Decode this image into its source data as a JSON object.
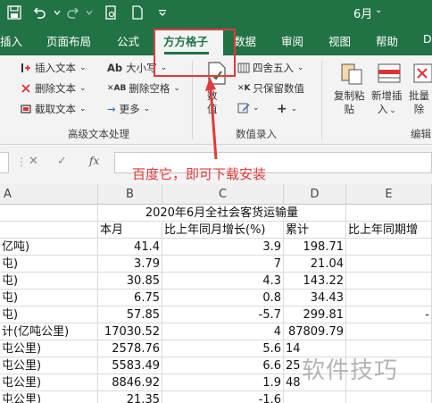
{
  "titlebar": {
    "doc_title": "6月",
    "title_dropdown": "⌄"
  },
  "tabs": [
    {
      "label": "插入",
      "active": false
    },
    {
      "label": "页面布局",
      "active": false
    },
    {
      "label": "公式",
      "active": false
    },
    {
      "label": "方方格子",
      "active": true
    },
    {
      "label": "数据",
      "active": false
    },
    {
      "label": "审阅",
      "active": false
    },
    {
      "label": "视图",
      "active": false
    },
    {
      "label": "帮助",
      "active": false
    },
    {
      "label": "D",
      "active": false
    }
  ],
  "ribbon": {
    "text_group": {
      "insert_text": "插入文本",
      "delete_text": "删除文本",
      "cut_text": "截取文本",
      "case": "大小写",
      "delete_space": "删除空格",
      "more": "更多",
      "label": "高级文本处理"
    },
    "number_group": {
      "round": "四舍五入",
      "keep_values": "只保留数值",
      "value_top": "数",
      "value_bottom": "值",
      "label": "数值录入"
    },
    "edit_group": {
      "copy_paste_top": "复制粘",
      "copy_paste_bottom": "贴",
      "new_insert_top": "新增插",
      "new_insert_bottom": "入",
      "batch_delete_top": "批量",
      "batch_delete_bottom": "除",
      "label": "编辑"
    }
  },
  "formula_bar": {
    "cancel": "✕",
    "confirm": "✓",
    "fx": "fx"
  },
  "annotation": {
    "callout": "百度它，即可下载安装",
    "watermark": "软件技巧"
  },
  "sheet": {
    "columns": [
      "A",
      "B",
      "C",
      "D",
      "E"
    ],
    "title_row": "2020年6月全社会客货运输量",
    "header_row": [
      "",
      "本月",
      "比上年同月增长(%)",
      "累计",
      "比上年同期增"
    ],
    "rows": [
      [
        "亿吨)",
        "41.4",
        "3.9",
        "198.71",
        ""
      ],
      [
        "屯)",
        "3.79",
        "7",
        "21.04",
        ""
      ],
      [
        "屯)",
        "30.85",
        "4.3",
        "143.22",
        ""
      ],
      [
        "屯)",
        "6.75",
        "0.8",
        "34.43",
        ""
      ],
      [
        "屯)",
        "57.85",
        "-5.7",
        "299.81",
        "-"
      ],
      [
        "计(亿吨公里)",
        "17030.52",
        "4",
        "87809.79",
        ""
      ],
      [
        "屯公里)",
        "2578.76",
        "5.6",
        "14",
        ""
      ],
      [
        "屯公里)",
        "5583.49",
        "6.6",
        "25",
        ""
      ],
      [
        "屯公里)",
        "8846.92",
        "1.9",
        "48",
        ""
      ],
      [
        "屯公里)",
        "21.35",
        "-1.6",
        "",
        ""
      ]
    ]
  }
}
